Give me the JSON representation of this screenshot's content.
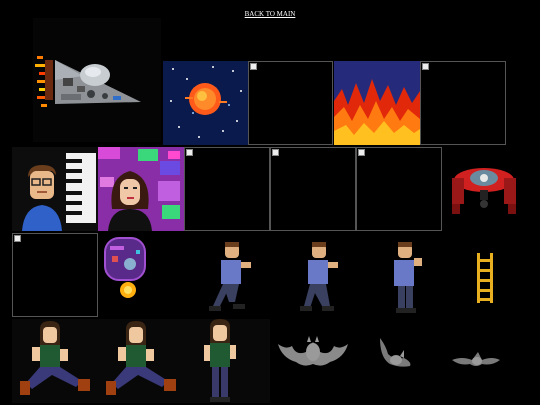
{
  "nav": {
    "back_link": "BACK TO MAIN"
  },
  "colors": {
    "background": "#000000",
    "link": "#ffffff",
    "broken_border": "#555555"
  },
  "sprites": [
    {
      "row": 1,
      "icon": "spaceship-icon",
      "broken": false
    },
    {
      "row": 1,
      "icon": "sun-starfield-icon",
      "broken": false
    },
    {
      "row": 1,
      "icon": "broken-image-icon",
      "broken": true
    },
    {
      "row": 1,
      "icon": "fire-icon",
      "broken": false
    },
    {
      "row": 1,
      "icon": "broken-image-icon",
      "broken": true
    },
    {
      "row": 2,
      "icon": "piano-player-portrait-icon",
      "broken": false
    },
    {
      "row": 2,
      "icon": "woman-portrait-icon",
      "broken": false
    },
    {
      "row": 2,
      "icon": "broken-image-icon",
      "broken": true
    },
    {
      "row": 2,
      "icon": "broken-image-icon",
      "broken": true
    },
    {
      "row": 2,
      "icon": "broken-image-icon",
      "broken": true
    },
    {
      "row": 2,
      "icon": "red-robot-crab-icon",
      "broken": false
    },
    {
      "row": 3,
      "icon": "broken-image-icon",
      "broken": true
    },
    {
      "row": 3,
      "icon": "purple-machine-icon",
      "broken": false
    },
    {
      "row": 3,
      "icon": "walking-man-icon",
      "broken": false
    },
    {
      "row": 3,
      "icon": "walking-man-icon",
      "broken": false
    },
    {
      "row": 3,
      "icon": "walking-man-icon",
      "broken": false
    },
    {
      "row": 3,
      "icon": "ladder-icon",
      "broken": false
    },
    {
      "row": 4,
      "icon": "running-woman-icon",
      "broken": false
    },
    {
      "row": 4,
      "icon": "running-woman-icon",
      "broken": false
    },
    {
      "row": 4,
      "icon": "standing-woman-icon",
      "broken": false
    },
    {
      "row": 4,
      "icon": "bat-icon",
      "broken": false
    },
    {
      "row": 4,
      "icon": "bat-icon",
      "broken": false
    },
    {
      "row": 4,
      "icon": "bat-icon",
      "broken": false
    }
  ]
}
